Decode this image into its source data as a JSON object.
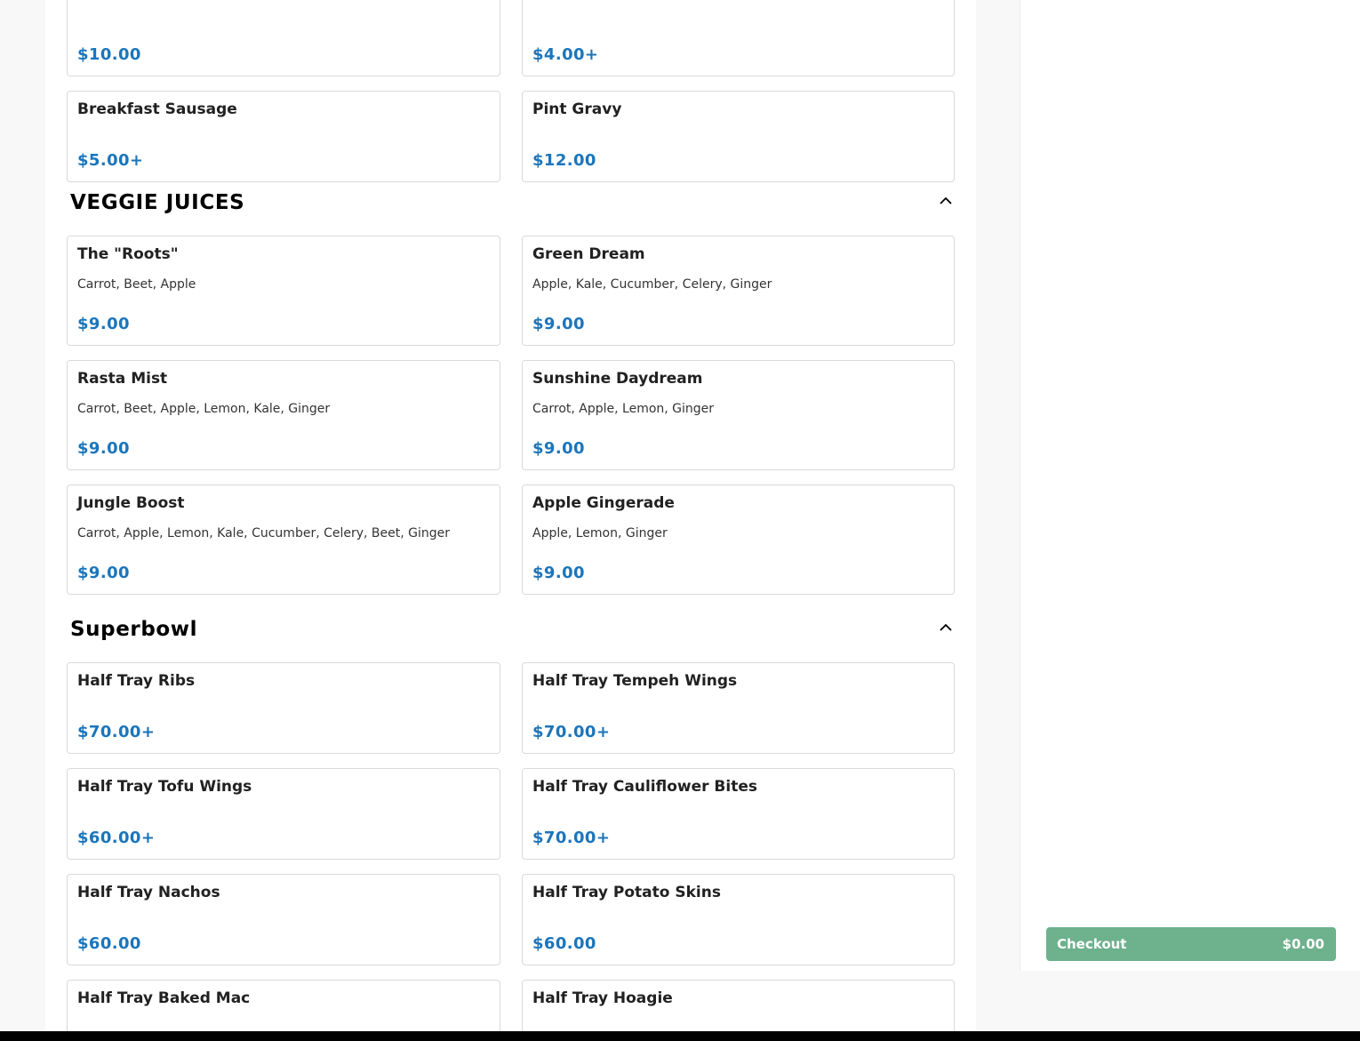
{
  "colors": {
    "price": "#1b75bb",
    "checkout_bg": "#6db18d",
    "page_bg": "#f8f8f8"
  },
  "top_items": [
    {
      "name": "",
      "price": "$10.00"
    },
    {
      "name": "",
      "price": "$4.00+"
    },
    {
      "name": "Breakfast Sausage",
      "price": "$5.00+"
    },
    {
      "name": "Pint Gravy",
      "price": "$12.00"
    }
  ],
  "sections": [
    {
      "title": "VEGGIE JUICES",
      "collapse_icon": "chevron-up-icon",
      "items": [
        {
          "name": "The \"Roots\"",
          "desc": "Carrot, Beet, Apple",
          "price": "$9.00"
        },
        {
          "name": "Green Dream",
          "desc": "Apple, Kale, Cucumber, Celery, Ginger",
          "price": "$9.00"
        },
        {
          "name": "Rasta Mist",
          "desc": "Carrot, Beet, Apple, Lemon, Kale, Ginger",
          "price": "$9.00"
        },
        {
          "name": "Sunshine Daydream",
          "desc": "Carrot, Apple, Lemon, Ginger",
          "price": "$9.00"
        },
        {
          "name": "Jungle Boost",
          "desc": "Carrot, Apple, Lemon, Kale, Cucumber, Celery, Beet, Ginger",
          "price": "$9.00"
        },
        {
          "name": "Apple Gingerade",
          "desc": "Apple, Lemon, Ginger",
          "price": "$9.00"
        }
      ]
    },
    {
      "title": "Superbowl",
      "collapse_icon": "chevron-up-icon",
      "items": [
        {
          "name": "Half Tray Ribs",
          "price": "$70.00+"
        },
        {
          "name": "Half Tray Tempeh Wings",
          "price": "$70.00+"
        },
        {
          "name": "Half Tray Tofu Wings",
          "price": "$60.00+"
        },
        {
          "name": "Half Tray Cauliflower Bites",
          "price": "$70.00+"
        },
        {
          "name": "Half Tray Nachos",
          "price": "$60.00"
        },
        {
          "name": "Half Tray Potato Skins",
          "price": "$60.00"
        },
        {
          "name": "Half Tray Baked Mac",
          "price": ""
        },
        {
          "name": "Half Tray Hoagie",
          "price": ""
        }
      ]
    }
  ],
  "checkout": {
    "label": "Checkout",
    "total": "$0.00"
  }
}
